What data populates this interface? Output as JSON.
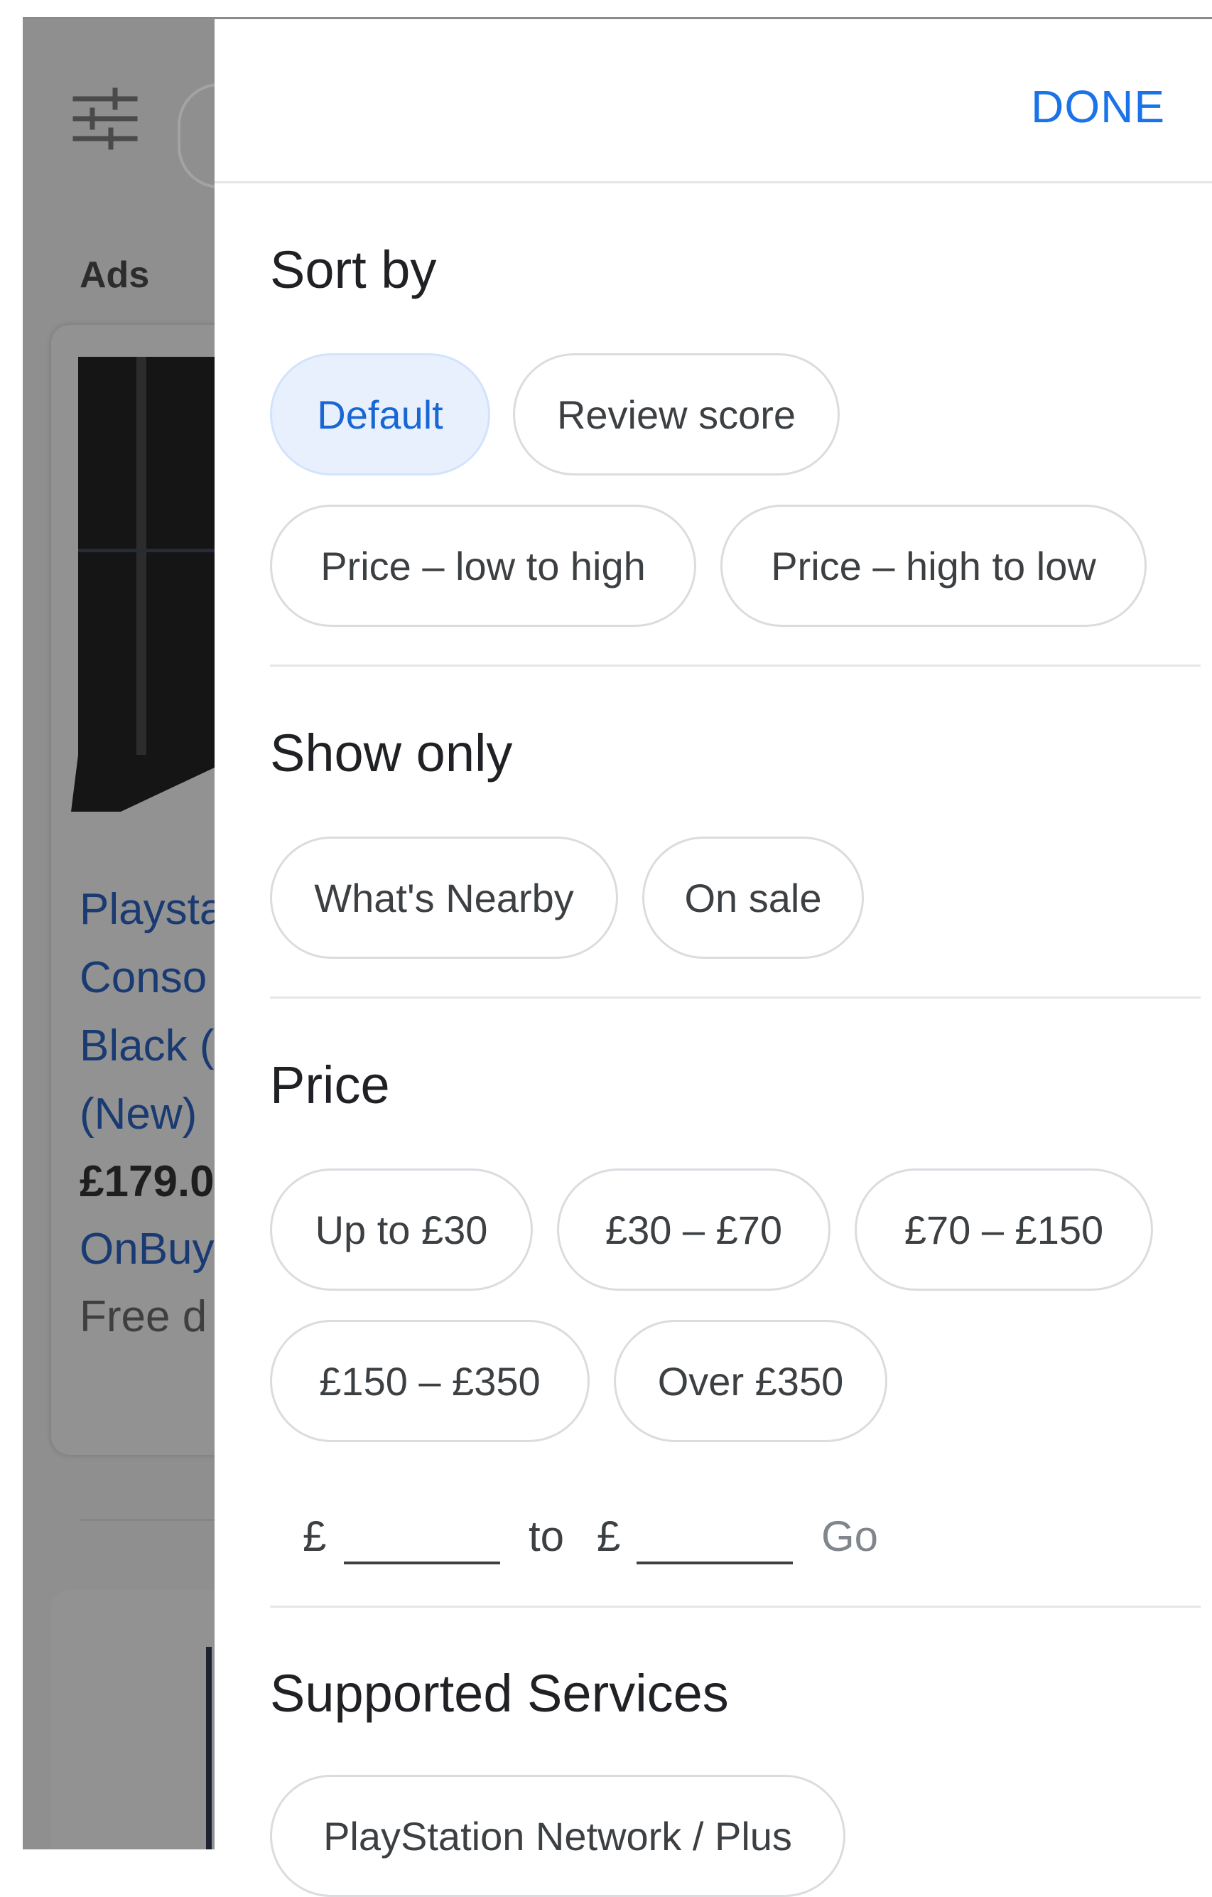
{
  "background": {
    "ads_label": "Ads",
    "product": {
      "title": "Playsta\nConso\nBlack (\n(New)",
      "price": "£179.0",
      "seller": "OnBuy",
      "delivery": "Free d"
    }
  },
  "panel": {
    "done_label": "DONE",
    "sort": {
      "title": "Sort by",
      "options": [
        "Default",
        "Review score",
        "Price – low to high",
        "Price – high to low"
      ],
      "selected": "Default"
    },
    "show_only": {
      "title": "Show only",
      "options": [
        "What's Nearby",
        "On sale"
      ]
    },
    "price": {
      "title": "Price",
      "options": [
        "Up to £30",
        "£30 – £70",
        "£70 – £150",
        "£150 – £350",
        "Over £350"
      ],
      "range": {
        "currency": "£",
        "to_label": "to",
        "min_value": "",
        "max_value": "",
        "go_label": "Go"
      }
    },
    "services": {
      "title": "Supported Services",
      "options": [
        "PlayStation Network / Plus"
      ]
    }
  },
  "colors": {
    "accent": "#1a73e8",
    "selected_chip_bg": "#e8f0fe",
    "scrim": "#8f8f8f",
    "link_dimmed": "#1a3a72"
  }
}
